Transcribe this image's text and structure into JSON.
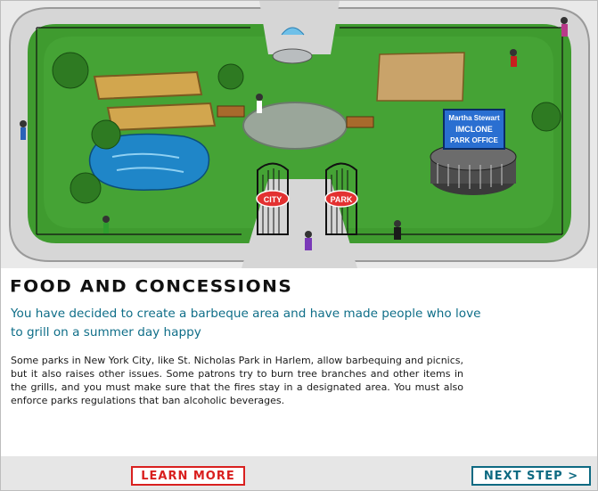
{
  "scene": {
    "signs": {
      "left_gate": "CITY",
      "right_gate": "PARK"
    },
    "office_sign": {
      "line1": "Martha Stewart",
      "line2": "IMCLONE",
      "line3": "PARK OFFICE"
    },
    "colors": {
      "grass": "#3f9b2f",
      "path": "#d8d8d8",
      "water": "#1f86c8",
      "sky_bg": "#e9e9e9",
      "sign_bg": "#2a6fd1"
    }
  },
  "content": {
    "title": "Food and Concessions",
    "subtitle": "You have decided to create a barbeque area and have made people who love to grill on a summer day happy",
    "body": "Some parks in New York City, like St. Nicholas Park in Harlem, allow barbequing and picnics, but it also raises other issues. Some patrons try to burn tree branches and other items in the grills, and you must make sure that the fires stay in a designated area. You must also enforce parks regulations that ban alcoholic beverages."
  },
  "footer": {
    "learn_more": "Learn More",
    "next_step": "Next Step >",
    "colors": {
      "learn_more": "#d9201f",
      "next_step": "#0e6a82"
    }
  }
}
